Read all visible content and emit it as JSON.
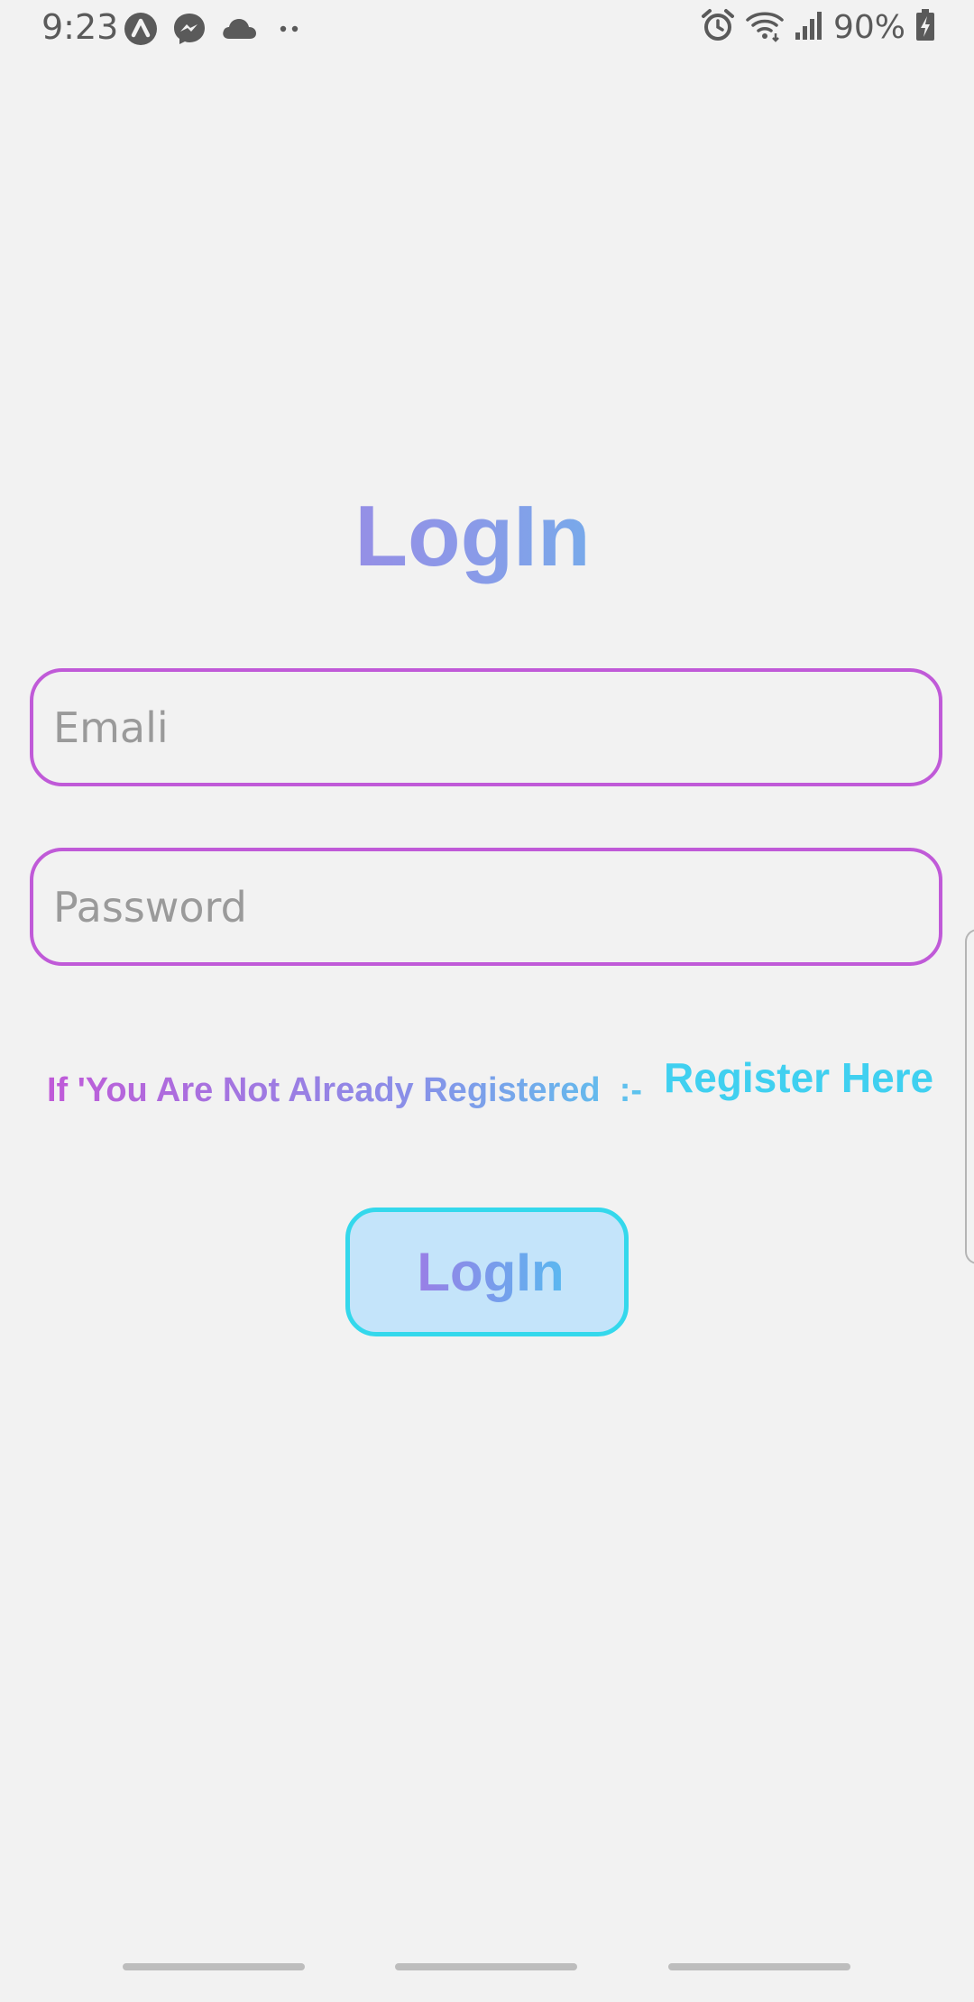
{
  "status_bar": {
    "time": "9:23",
    "battery_text": "90%",
    "left_icons": [
      "arrow-up-circle-icon",
      "messenger-icon",
      "cloud-icon",
      "more-dots-icon"
    ],
    "right_icons": [
      "alarm-icon",
      "wifi-icon",
      "signal-icon",
      "battery-charging-icon"
    ]
  },
  "login": {
    "title": "LogIn",
    "email_placeholder": "Emali",
    "password_placeholder": "Password",
    "register_prompt": "If 'You Are Not Already Registered  :-",
    "register_link": "Register Here",
    "login_button": "LogIn"
  },
  "colors": {
    "background": "#f2f2f2",
    "field_border": "#c05ad8",
    "gradient_start": "#b76ee0",
    "gradient_end": "#40d8f0",
    "button_border": "#34d8ec",
    "button_fill": "#c4e4fa"
  }
}
